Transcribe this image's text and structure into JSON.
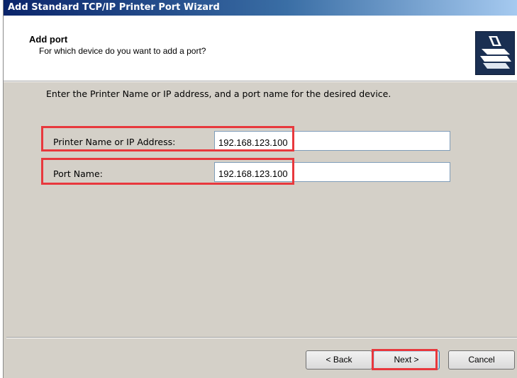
{
  "window": {
    "title": "Add Standard TCP/IP Printer Port Wizard"
  },
  "header": {
    "title": "Add port",
    "subtitle": "For which device do you want to add a port?",
    "icon": "printer-icon"
  },
  "body": {
    "instruction": "Enter the Printer Name or IP address, and a port name for the desired device.",
    "fields": [
      {
        "label": "Printer Name or IP Address:",
        "value": "192.168.123.100"
      },
      {
        "label": "Port Name:",
        "value": "192.168.123.100"
      }
    ]
  },
  "buttons": {
    "back": "< Back",
    "next": "Next >",
    "cancel": "Cancel"
  },
  "colors": {
    "highlight": "#e8383d",
    "dialog_bg": "#d4d0c8"
  }
}
